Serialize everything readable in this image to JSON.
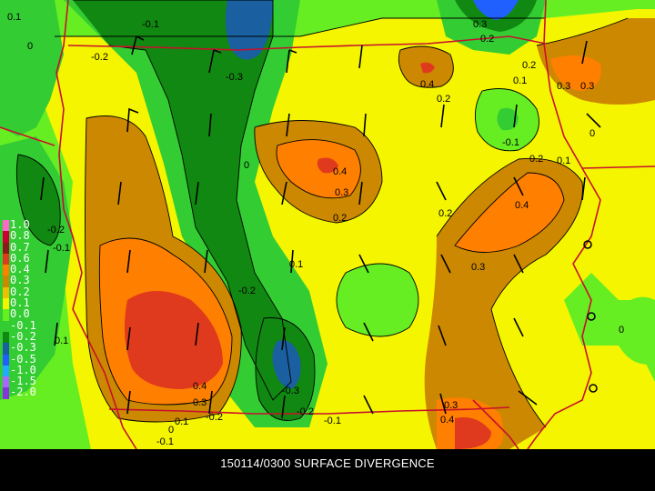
{
  "caption": "150114/0300 SURFACE DIVERGENCE",
  "colors": {
    "background": "#000000",
    "state_border": "#c8102e",
    "contour": "#000000",
    "barb": "#000000"
  },
  "legend": [
    {
      "label": "1.0",
      "color": "#ff66cc"
    },
    {
      "label": "0.8",
      "color": "#cc0033"
    },
    {
      "label": "0.7",
      "color": "#8b1a1a"
    },
    {
      "label": "0.6",
      "color": "#e03a1e"
    },
    {
      "label": "0.4",
      "color": "#ff7f00"
    },
    {
      "label": "0.3",
      "color": "#cc8800"
    },
    {
      "label": "0.2",
      "color": "#f0c000"
    },
    {
      "label": "0.1",
      "color": "#f5f500"
    },
    {
      "label": "0.0",
      "color": "#66ee22"
    },
    {
      "label": "-0.1",
      "color": "#33cc33"
    },
    {
      "label": "-0.2",
      "color": "#118811"
    },
    {
      "label": "-0.3",
      "color": "#1a5fa0"
    },
    {
      "label": "-0.5",
      "color": "#2060ff"
    },
    {
      "label": "-1.0",
      "color": "#22aaff"
    },
    {
      "label": "-1.5",
      "color": "#aa66ff"
    },
    {
      "label": "-2.0",
      "color": "#8833dd"
    }
  ],
  "contour_labels": [
    "0.1",
    "0",
    "-0.1",
    "-0.2",
    "-0.3",
    "0.2",
    "0.3",
    "0.4",
    "0.3",
    "0.2",
    "0.2",
    "0.1",
    "0.3",
    "0",
    "0.4",
    "0.3",
    "0.2",
    "0.2",
    "0.1",
    "0.4",
    "0.3",
    "-0.2",
    "-0.1",
    "0.1",
    "-0.2",
    "0.4",
    "0.3",
    "-0.3",
    "-0.2",
    "-0.1",
    "0.1",
    "-0.2",
    "0",
    "-0.1",
    "0.3",
    "0.4",
    "0",
    "0.2",
    "0.1",
    "0",
    "-0.1"
  ]
}
